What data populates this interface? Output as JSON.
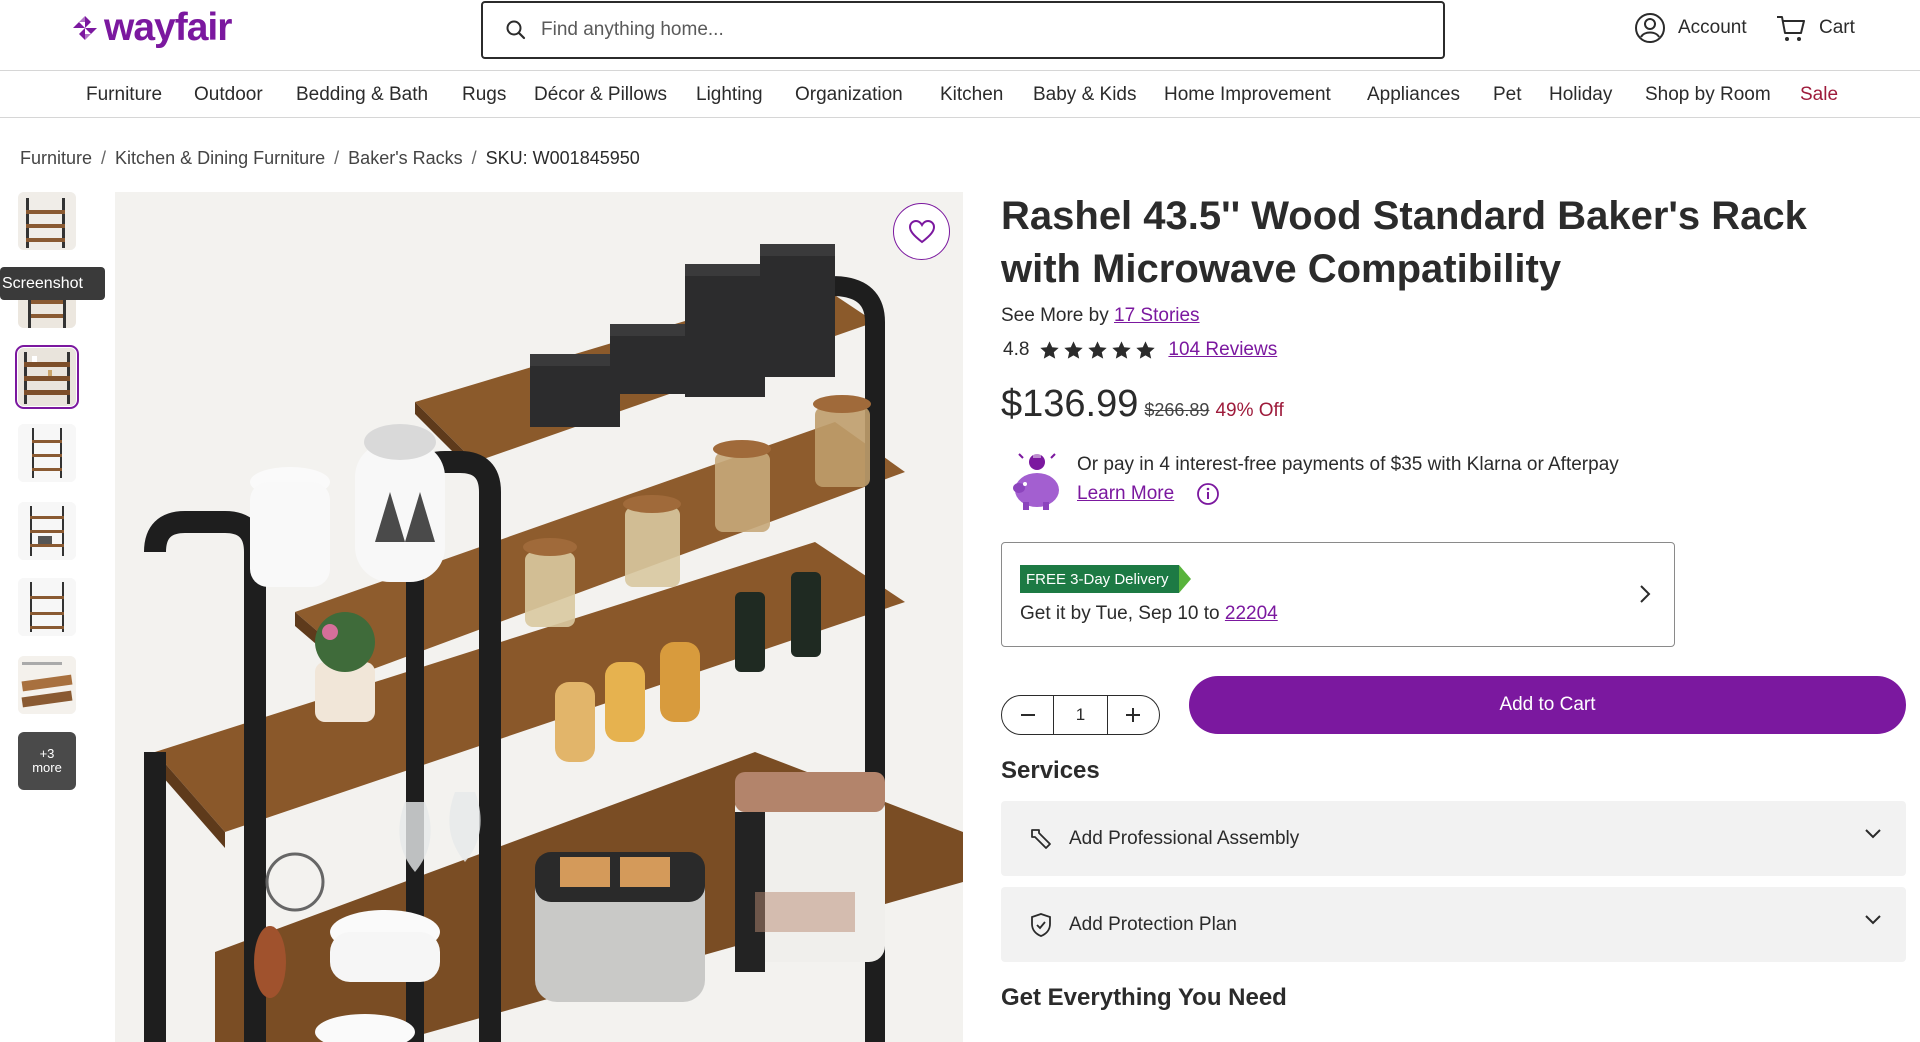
{
  "header": {
    "logo_text": "wayfair",
    "search_placeholder": "Find anything home...",
    "account_label": "Account",
    "cart_label": "Cart"
  },
  "nav": {
    "items": [
      "Furniture",
      "Outdoor",
      "Bedding & Bath",
      "Rugs",
      "Décor & Pillows",
      "Lighting",
      "Organization",
      "Kitchen",
      "Baby & Kids",
      "Home Improvement",
      "Appliances",
      "Pet",
      "Holiday",
      "Shop by Room",
      "Sale"
    ]
  },
  "breadcrumb": {
    "items": [
      "Furniture",
      "Kitchen & Dining Furniture",
      "Baker's Racks"
    ],
    "separator": "/",
    "sku": "SKU: W001845950"
  },
  "gallery": {
    "tooltip": "Screenshot",
    "more_count": "+3",
    "more_label": "more",
    "selected_index": 2
  },
  "product": {
    "title": "Rashel 43.5'' Wood Standard Baker's Rack with Microwave Compatibility",
    "see_more_prefix": "See More by",
    "brand": "17 Stories",
    "rating": "4.8",
    "stars": 5,
    "reviews": "104 Reviews",
    "price": "$136.99",
    "original_price": "$266.89",
    "discount": "49% Off"
  },
  "klarna": {
    "text": "Or pay in 4 interest-free payments of $35 with Klarna or Afterpay",
    "learn_more": "Learn More"
  },
  "delivery": {
    "badge": "FREE 3-Day Delivery",
    "text_prefix": "Get it by Tue, Sep 10 to",
    "zip": "22204"
  },
  "purchase": {
    "quantity": "1",
    "add_to_cart": "Add to Cart"
  },
  "services": {
    "title": "Services",
    "assembly": "Add Professional Assembly",
    "protection": "Add Protection Plan"
  },
  "section_title": "Get Everything You Need",
  "colors": {
    "brand": "#7b189f",
    "sale": "#9e1b3b",
    "delivery_green": "#1d7a44"
  }
}
